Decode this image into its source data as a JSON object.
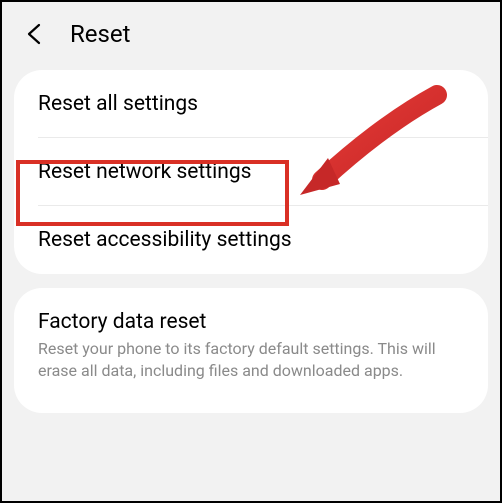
{
  "header": {
    "title": "Reset"
  },
  "section1": {
    "items": [
      {
        "title": "Reset all settings"
      },
      {
        "title": "Reset network settings"
      },
      {
        "title": "Reset accessibility settings"
      }
    ]
  },
  "section2": {
    "items": [
      {
        "title": "Factory data reset",
        "subtitle": "Reset your phone to its factory default settings. This will erase all data, including files and downloaded apps."
      }
    ]
  },
  "annotation": {
    "highlight_color": "#d93025",
    "arrow_color": "#d93025"
  }
}
